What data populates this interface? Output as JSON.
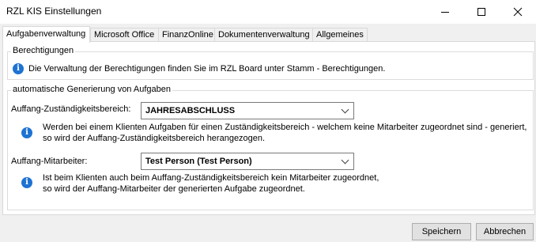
{
  "window": {
    "title": "RZL KIS Einstellungen"
  },
  "tabs": [
    {
      "label": "Aufgabenverwaltung",
      "active": true
    },
    {
      "label": "Microsoft Office",
      "active": false
    },
    {
      "label": "FinanzOnline",
      "active": false
    },
    {
      "label": "Dokumentenverwaltung",
      "active": false
    },
    {
      "label": "Allgemeines",
      "active": false
    }
  ],
  "berechtigungen": {
    "legend": "Berechtigungen",
    "info": "Die Verwaltung der Berechtigungen finden Sie im RZL Board unter Stamm - Berechtigungen."
  },
  "auto_gen": {
    "legend": "automatische Generierung von Aufgaben",
    "zustaendigkeit_label": "Auffang-Zuständigkeitsbereich:",
    "zustaendigkeit_value": "JAHRESABSCHLUSS",
    "zustaendigkeit_info_1": "Werden bei einem Klienten Aufgaben für einen Zuständigkeitsbereich - welchem keine Mitarbeiter zugeordnet sind - generiert,",
    "zustaendigkeit_info_2": "so wird der Auffang-Zuständigkeitsbereich herangezogen.",
    "mitarbeiter_label": "Auffang-Mitarbeiter:",
    "mitarbeiter_value": "Test Person (Test Person)",
    "mitarbeiter_info_1": "Ist beim Klienten auch beim Auffang-Zuständigkeitsbereich kein Mitarbeiter zugeordnet,",
    "mitarbeiter_info_2": "so wird der Auffang-Mitarbeiter der generierten Aufgabe zugeordnet."
  },
  "buttons": {
    "save": "Speichern",
    "cancel": "Abbrechen"
  },
  "colors": {
    "info_icon": "#1e73d2",
    "background": "#f0f0f0"
  }
}
